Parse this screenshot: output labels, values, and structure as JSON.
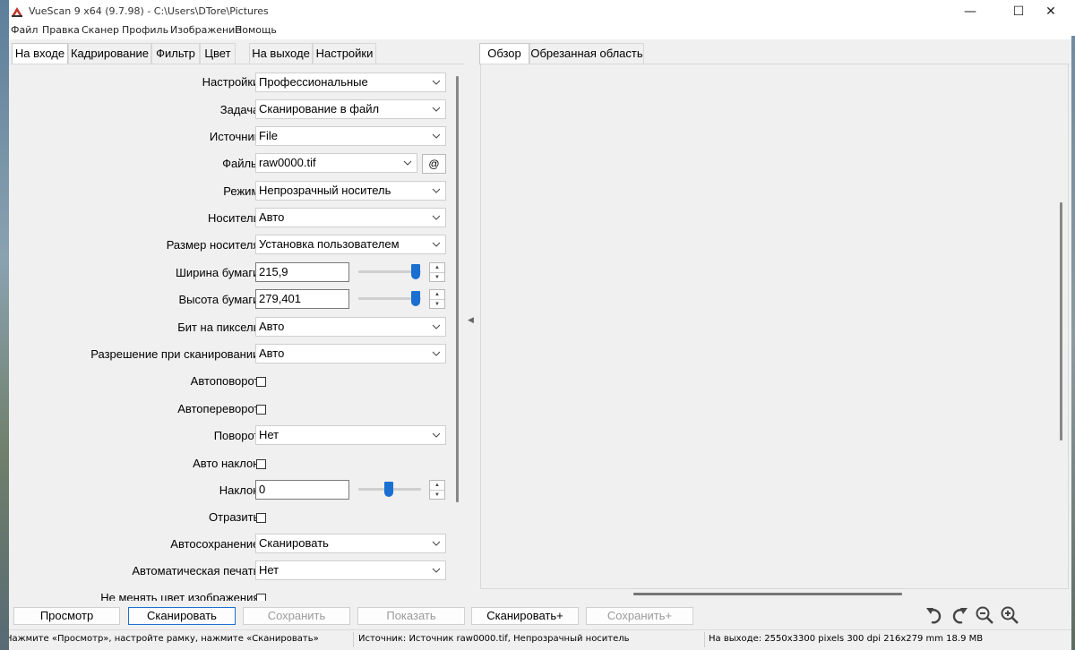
{
  "window": {
    "title": "VueScan 9 x64 (9.7.98) - C:\\Users\\DTore\\Pictures",
    "controls": {
      "minimize": "—",
      "maximize": "☐",
      "close": "✕"
    }
  },
  "menu": [
    "Файл",
    "Правка",
    "Сканер",
    "Профиль",
    "Изображение",
    "Помощь"
  ],
  "left_tabs": [
    "На входе",
    "Кадрирование",
    "Фильтр",
    "Цвет",
    "На выходе",
    "Настройки"
  ],
  "right_tabs": [
    "Обзор",
    "Обрезанная область"
  ],
  "settings": {
    "preset": {
      "label": "Настройки:",
      "value": "Профессиональные"
    },
    "task": {
      "label": "Задача:",
      "value": "Сканирование в файл"
    },
    "source": {
      "label": "Источник:",
      "value": "File"
    },
    "files": {
      "label": "Файлы:",
      "value": "raw0000.tif",
      "button": "@"
    },
    "mode": {
      "label": "Режим:",
      "value": "Непрозрачный носитель"
    },
    "media": {
      "label": "Носитель:",
      "value": "Авто"
    },
    "media_size": {
      "label": "Размер носителя:",
      "value": "Установка пользователем"
    },
    "paper_width": {
      "label": "Ширина бумаги:",
      "value": "215,9",
      "slider_fraction": 1.0
    },
    "paper_height": {
      "label": "Высота бумаги:",
      "value": "279,401",
      "slider_fraction": 1.0
    },
    "bits_per_pixel": {
      "label": "Бит на пиксель:",
      "value": "Авто"
    },
    "scan_resolution": {
      "label": "Разрешение при сканировании:",
      "value": "Авто"
    },
    "auto_rotate": {
      "label": "Автоповорот:",
      "checked": false
    },
    "auto_flip": {
      "label": "Автопереворот:",
      "checked": false
    },
    "rotation": {
      "label": "Поворот:",
      "value": "Нет"
    },
    "auto_skew": {
      "label": "Авто наклон:",
      "checked": false
    },
    "skew": {
      "label": "Наклон:",
      "value": "0",
      "slider_fraction": 0.5
    },
    "mirror": {
      "label": "Отразить:",
      "checked": false
    },
    "auto_save": {
      "label": "Автосохранение:",
      "value": "Сканировать"
    },
    "auto_print": {
      "label": "Автоматическая печать:",
      "value": "Нет"
    },
    "keep_color": {
      "label": "Не менять цвет изображения:",
      "checked": false
    }
  },
  "buttons": {
    "preview": "Просмотр",
    "scan": "Сканировать",
    "save": "Сохранить",
    "show": "Показать",
    "scan_plus": "Сканировать+",
    "save_plus": "Сохранить+"
  },
  "status": {
    "hint": "Нажмите «Просмотр», настройте рамку, нажмите «Сканировать»",
    "source_info": "Источник: Источник raw0000.tif, Непрозрачный носитель",
    "output_info": "На выходе: 2550x3300 pixels 300 dpi 216x279 mm 18.9 MB"
  },
  "colors": {
    "accent": "#1a6fd1"
  }
}
